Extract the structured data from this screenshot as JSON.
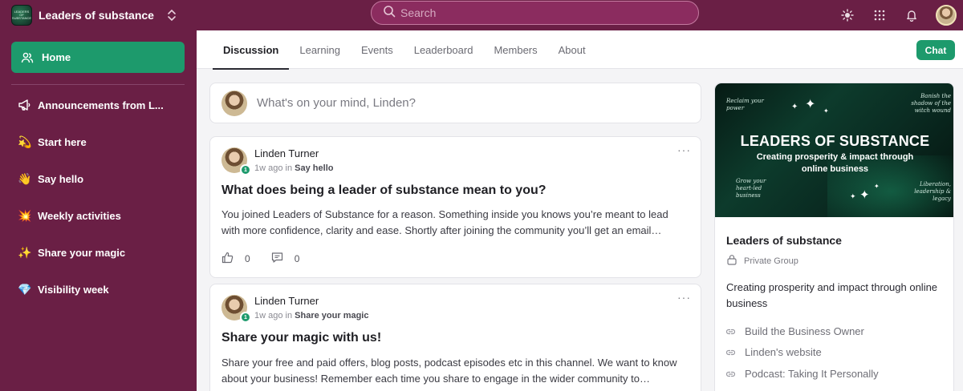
{
  "app": {
    "logo_text": "LEADERS OF SUBSTANCE",
    "name": "Leaders of substance",
    "search_placeholder": "Search"
  },
  "top_icons": [
    "sun-icon",
    "apps-grid-icon",
    "bell-icon"
  ],
  "sidebar": {
    "home_label": "Home",
    "items": [
      {
        "emoji": "📢",
        "label": "Announcements from L..."
      },
      {
        "emoji": "💫",
        "label": "Start here"
      },
      {
        "emoji": "👋",
        "label": "Say hello"
      },
      {
        "emoji": "💥",
        "label": "Weekly activities"
      },
      {
        "emoji": "✨",
        "label": "Share your magic"
      },
      {
        "emoji": "💎",
        "label": "Visibility week"
      }
    ]
  },
  "tabs": [
    "Discussion",
    "Learning",
    "Events",
    "Leaderboard",
    "Members",
    "About"
  ],
  "active_tab": "Discussion",
  "chat_label": "Chat",
  "composer": {
    "placeholder": "What's on your mind, Linden?"
  },
  "posts": [
    {
      "author": "Linden Turner",
      "level": "1",
      "time": "1w ago",
      "in_word": "in",
      "channel": "Say hello",
      "title": "What does being a leader of substance mean to you?",
      "body": "You joined Leaders of Substance for a reason. Something inside you knows you’re meant to lead with more confidence, clarity and ease. Shortly after joining the community you’ll get an email…",
      "likes": "0",
      "comments": "0"
    },
    {
      "author": "Linden Turner",
      "level": "1",
      "time": "1w ago",
      "in_word": "in",
      "channel": "Share your magic",
      "title": "Share your magic with us!",
      "body": "Share your free and paid offers, blog posts, podcast episodes etc in this channel. We want to know about your business! Remember each time you share to engage in the wider community to…"
    }
  ],
  "group_panel": {
    "banner_title": "LEADERS OF SUBSTANCE",
    "banner_subtitle": "Creating prosperity & impact through online business",
    "script_texts": [
      "Reclaim your power",
      "Banish the shadow of the witch wound",
      "Grow your heart-led business",
      "Liberation, leadership & legacy"
    ],
    "name": "Leaders of substance",
    "privacy": "Private Group",
    "description": "Creating prosperity and impact through online business",
    "links": [
      "Build the Business Owner",
      "Linden's website",
      "Podcast: Taking It Personally"
    ]
  },
  "colors": {
    "brand_purple": "#6a1f45",
    "accent_green": "#1d9a6c",
    "search_bg": "#8b2c5f"
  }
}
